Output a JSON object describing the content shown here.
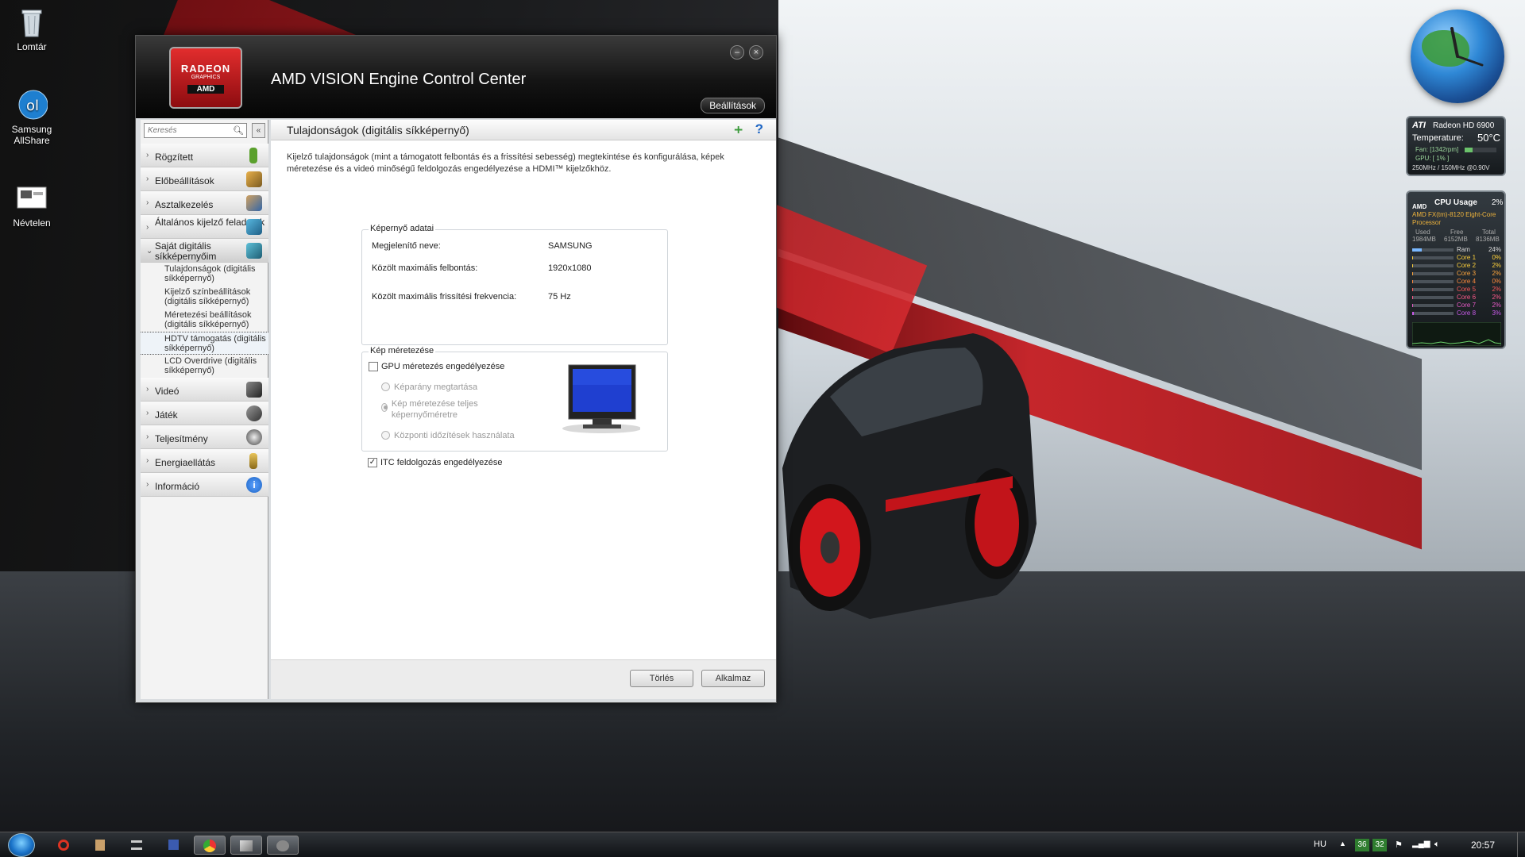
{
  "desktop": {
    "icons": [
      {
        "label": "Lomtár",
        "glyph": "recycle-bin"
      },
      {
        "label": "Samsung AllShare",
        "glyph": "allshare"
      },
      {
        "label": "Névtelen",
        "glyph": "image-file"
      }
    ]
  },
  "window": {
    "logo": {
      "line1": "RADEON",
      "line2": "GRAPHICS",
      "line3": "AMD"
    },
    "title": "AMD VISION Engine Control Center",
    "settings_label": "Beállítások",
    "minimize_glyph": "–",
    "close_glyph": "×"
  },
  "sidebar": {
    "search_placeholder": "Keresés",
    "collapse_glyph": "«",
    "items": [
      {
        "label": "Rögzített",
        "icon": "pin-icon",
        "color": "#5aa02c"
      },
      {
        "label": "Előbeállítások",
        "icon": "presets-icon",
        "color": "#c98a2c"
      },
      {
        "label": "Asztalkezelés",
        "icon": "desktop-icon",
        "color": "#3366a8"
      },
      {
        "label": "Általános kijelző feladatok",
        "icon": "display-tasks-icon",
        "color": "#2d8ab6"
      },
      {
        "label": "Saját digitális síkképernyőim",
        "icon": "flat-panel-icon",
        "color": "#2d7fa0"
      }
    ],
    "subitems": [
      "Tulajdonságok (digitális síkképernyő)",
      "Kijelző színbeállítások (digitális síkképernyő)",
      "Méretezési beállítások (digitális síkképernyő)",
      "HDTV támogatás (digitális síkképernyő)",
      "LCD Overdrive (digitális síkképernyő)"
    ],
    "items_after": [
      {
        "label": "Videó",
        "icon": "video-icon",
        "color": "#444"
      },
      {
        "label": "Játék",
        "icon": "gamepad-icon",
        "color": "#444"
      },
      {
        "label": "Teljesítmény",
        "icon": "gauge-icon",
        "color": "#555"
      },
      {
        "label": "Energiaellátás",
        "icon": "battery-icon",
        "color": "#c9a13a"
      },
      {
        "label": "Információ",
        "icon": "info-icon",
        "color": "#1f66c4"
      }
    ]
  },
  "content": {
    "title": "Tulajdonságok (digitális síkképernyő)",
    "description": "Kijelző tulajdonságok (mint a támogatott felbontás és a frissítési sebesség) megtekintése és konfigurálása, képek méretezése és a videó minőségű feldolgozás engedélyezése a HDMI™ kijelzőkhöz.",
    "display_group": {
      "title": "Képernyő adatai",
      "rows": [
        {
          "label": "Megjelenítő neve:",
          "value": "SAMSUNG"
        },
        {
          "label": "Közölt maximális felbontás:",
          "value": "1920x1080"
        },
        {
          "label": "Közölt maximális frissítési frekvencia:",
          "value": "75 Hz"
        }
      ]
    },
    "scaling_group": {
      "title": "Kép méretezése",
      "gpu_scaling_label": "GPU méretezés engedélyezése",
      "gpu_scaling_checked": false,
      "radios": [
        {
          "label": "Képarány megtartása",
          "selected": false
        },
        {
          "label": "Kép méretezése teljes képernyőméretre",
          "selected": true
        },
        {
          "label": "Központi időzítések használata",
          "selected": false
        }
      ]
    },
    "itc_label": "ITC feldolgozás engedélyezése",
    "itc_checked": true,
    "buttons": {
      "discard": "Törlés",
      "apply": "Alkalmaz"
    }
  },
  "gadgets": {
    "gpu": {
      "brand": "ATI",
      "name": "Radeon HD 6900",
      "temperature_label": "Temperature:",
      "temperature_value": "50°C",
      "fan": "Fan: [1342rpm]",
      "gpu_load": "GPU: [ 1% ]",
      "clocks": "250MHz / 150MHz @0.90V"
    },
    "cpu": {
      "brand": "AMD",
      "title": "CPU Usage",
      "usage": "2%",
      "processor": "AMD FX(tm)-8120 Eight-Core Processor",
      "mem_headers": [
        "Used",
        "Free",
        "Total"
      ],
      "mem_values": [
        "1984MB",
        "6152MB",
        "8136MB"
      ],
      "rows": [
        {
          "label": "Ram",
          "value": "24%",
          "color": "#dddddd"
        },
        {
          "label": "Core 1",
          "value": "0%",
          "color": "#ffd23c"
        },
        {
          "label": "Core 2",
          "value": "2%",
          "color": "#ffd23c"
        },
        {
          "label": "Core 3",
          "value": "2%",
          "color": "#ffa63c"
        },
        {
          "label": "Core 4",
          "value": "0%",
          "color": "#ff8a3c"
        },
        {
          "label": "Core 5",
          "value": "2%",
          "color": "#ff5a5a"
        },
        {
          "label": "Core 6",
          "value": "2%",
          "color": "#ff5a8a"
        },
        {
          "label": "Core 7",
          "value": "2%",
          "color": "#e85ac8"
        },
        {
          "label": "Core 8",
          "value": "3%",
          "color": "#c85ae8"
        }
      ]
    }
  },
  "taskbar": {
    "language": "HU",
    "tray_numbers": [
      "36",
      "32"
    ],
    "time": "20:57"
  }
}
